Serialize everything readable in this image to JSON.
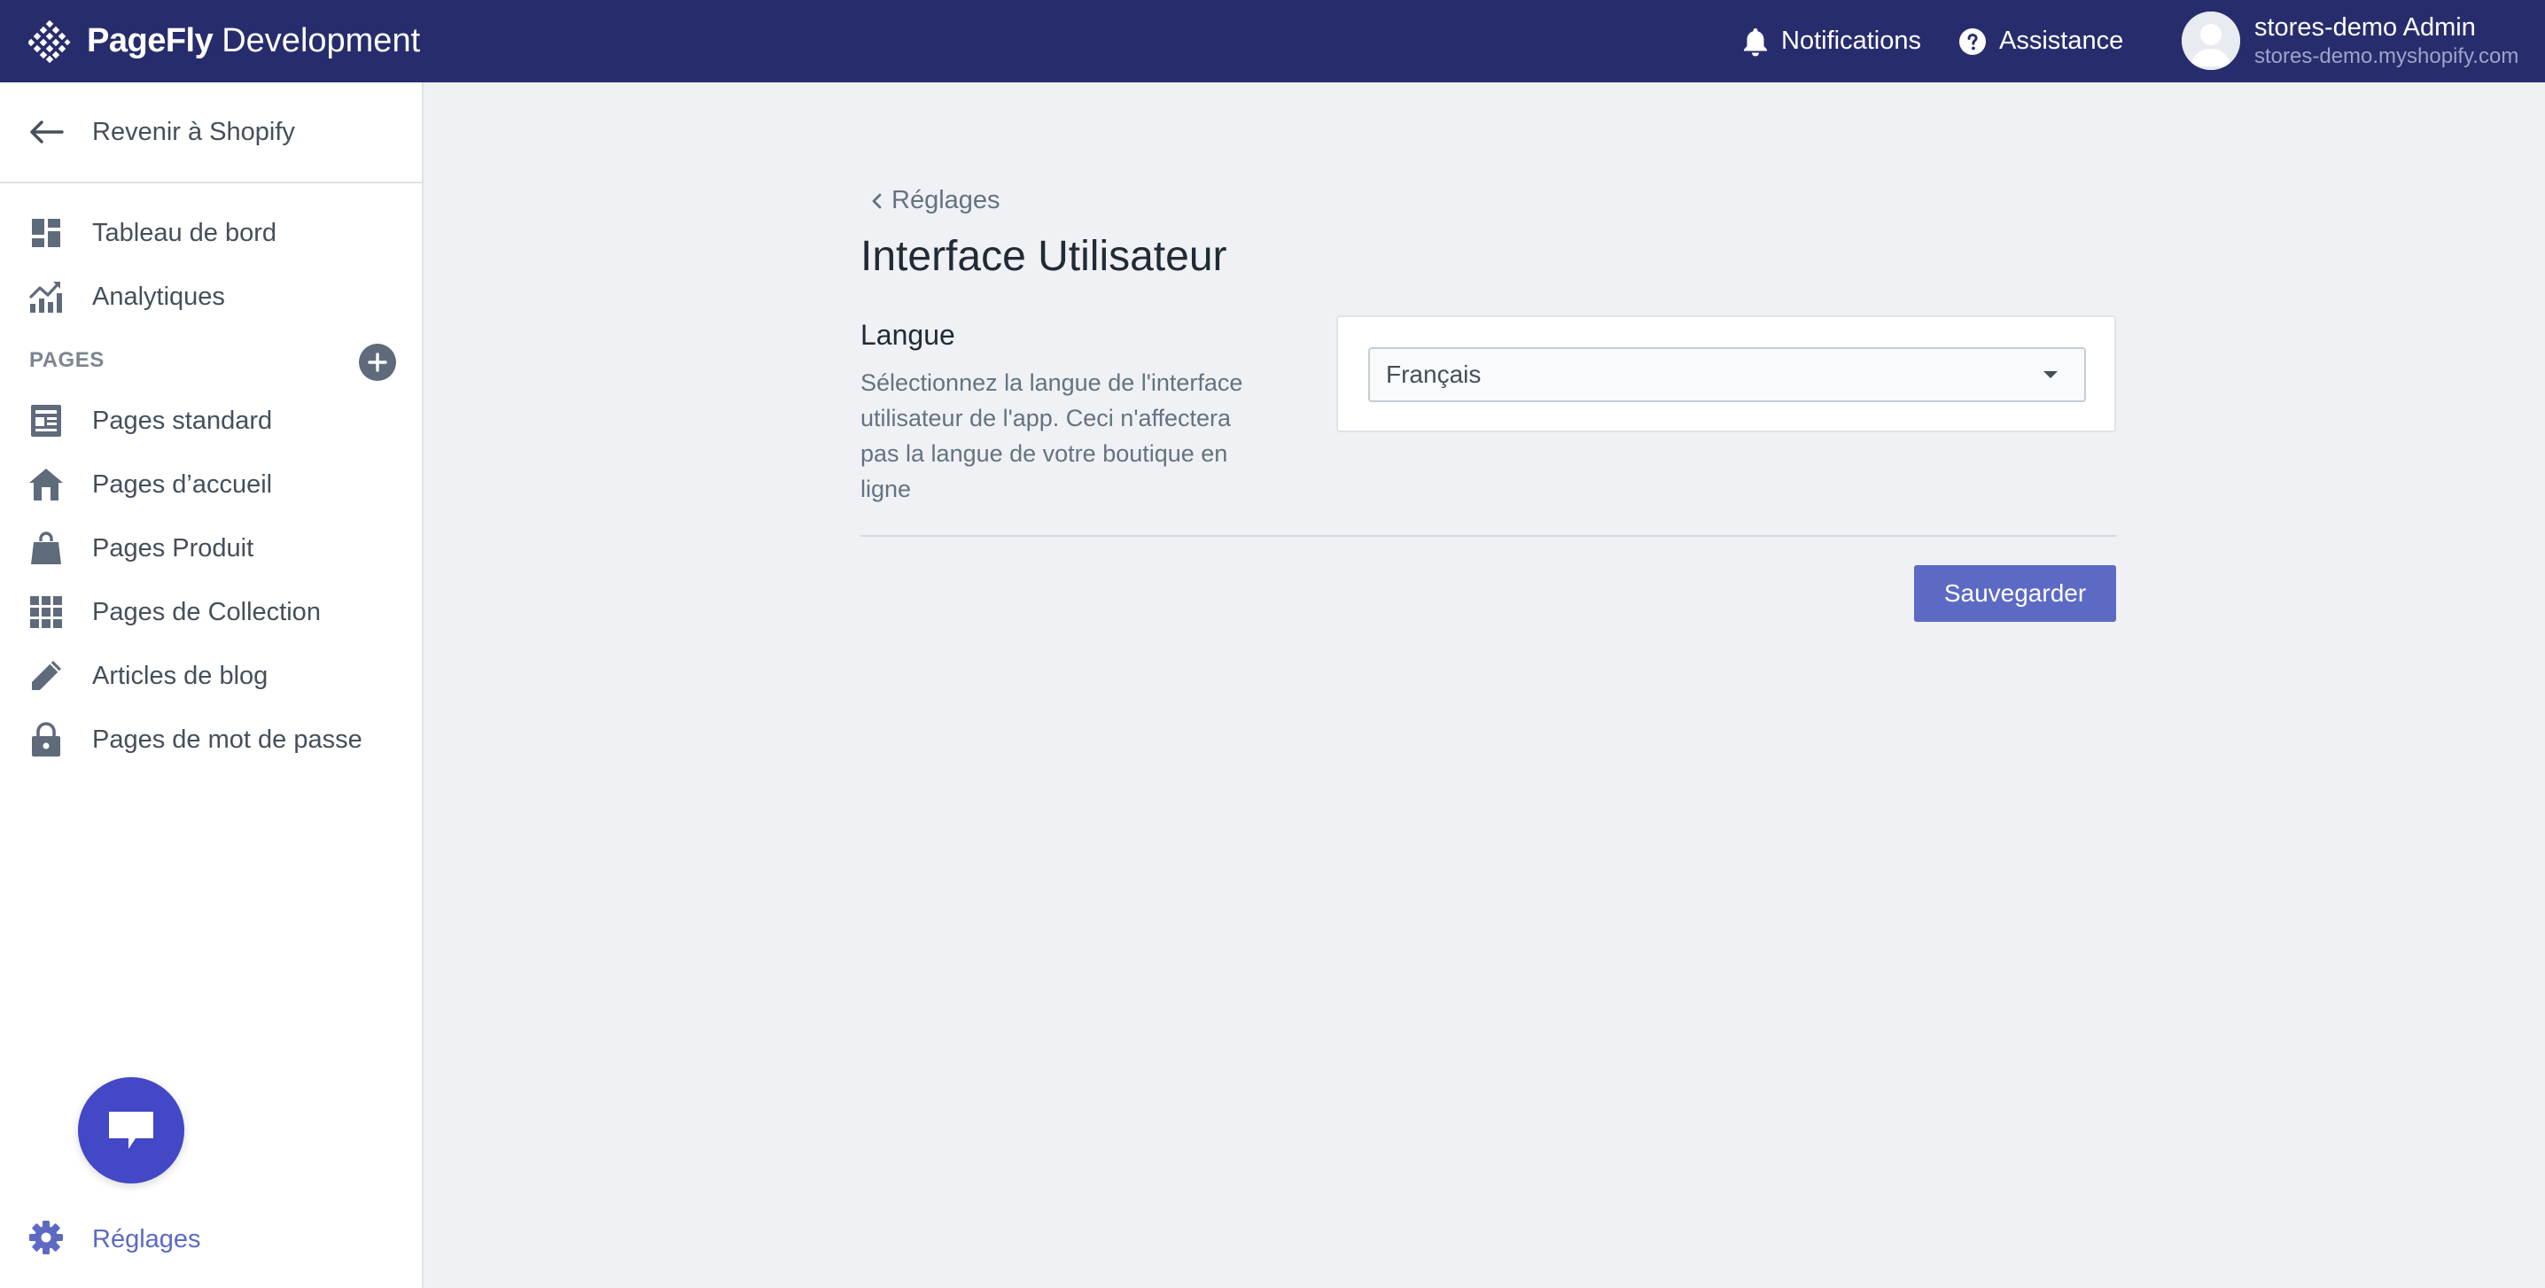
{
  "app": {
    "brand_name": "PageFly",
    "brand_suffix": "Development"
  },
  "topbar": {
    "notifications_label": "Notifications",
    "assistance_label": "Assistance",
    "account_name": "stores-demo Admin",
    "account_domain": "stores-demo.myshopify.com"
  },
  "sidebar": {
    "back_label": "Revenir à Shopify",
    "top_items": [
      {
        "label": "Tableau de bord",
        "icon": "dashboard-icon"
      },
      {
        "label": "Analytiques",
        "icon": "analytics-icon"
      }
    ],
    "section_title": "PAGES",
    "page_items": [
      {
        "label": "Pages standard",
        "icon": "page-icon"
      },
      {
        "label": "Pages d’accueil",
        "icon": "home-icon"
      },
      {
        "label": "Pages Produit",
        "icon": "bag-icon"
      },
      {
        "label": "Pages de Collection",
        "icon": "grid-icon"
      },
      {
        "label": "Articles de blog",
        "icon": "pencil-icon"
      },
      {
        "label": "Pages de mot de passe",
        "icon": "lock-icon"
      }
    ],
    "settings_label": "Réglages"
  },
  "main": {
    "breadcrumb": "Réglages",
    "title": "Interface Utilisateur",
    "section_title": "Langue",
    "section_description": "Sélectionnez la langue de l'interface utilisateur de l'app. Ceci n'affectera pas la langue de votre boutique en ligne",
    "language_selected": "Français",
    "save_label": "Sauvegarder"
  },
  "colors": {
    "topbar_bg": "#272d6c",
    "accent": "#5c6ac4",
    "chat_bg": "#4248c6",
    "page_bg": "#f0f1f4"
  }
}
